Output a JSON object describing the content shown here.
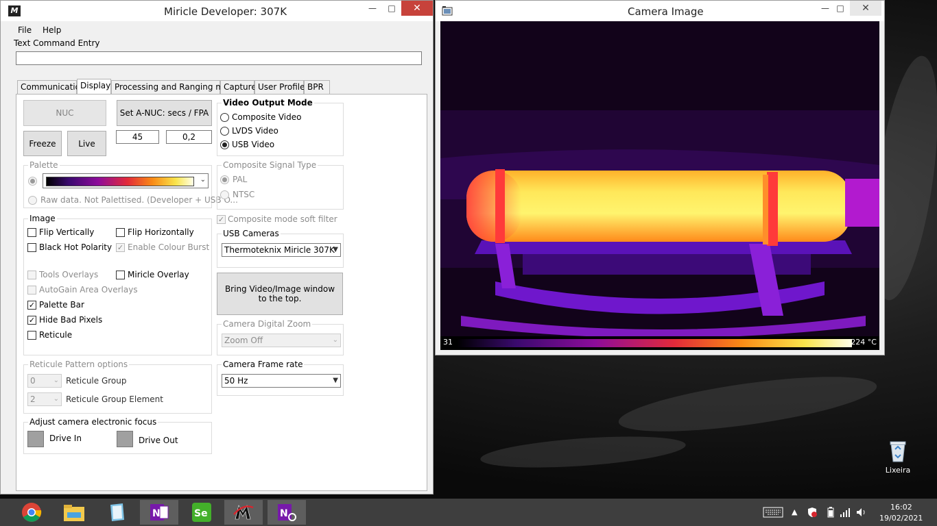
{
  "app_window": {
    "title": "Miricle Developer:  307K",
    "menu": {
      "file": "File",
      "help": "Help"
    },
    "text_command": {
      "label": "Text Command Entry",
      "value": ""
    },
    "tabs": [
      "Communications",
      "Display",
      "Processing and Ranging modes",
      "Capture",
      "User Profiles",
      "BPR"
    ],
    "active_tab": "Display",
    "buttons": {
      "nuc": "NUC",
      "set_anuc": "Set A-NUC:  secs / FPA",
      "freeze": "Freeze",
      "live": "Live",
      "bring_video": "Bring Video/Image window to the top."
    },
    "anuc_secs": "45",
    "anuc_fpa": "0,2",
    "video_output": {
      "title": "Video Output Mode",
      "options": [
        "Composite Video",
        "LVDS Video",
        "USB Video"
      ],
      "selected": "USB Video"
    },
    "palette": {
      "title": "Palette",
      "raw_label": "Raw data. Not Palettised. (Developer + USB O..."
    },
    "composite_signal": {
      "title": "Composite Signal Type",
      "options": [
        "PAL",
        "NTSC"
      ],
      "selected": "PAL"
    },
    "soft_filter": {
      "label": "Composite mode soft filter",
      "checked": true
    },
    "usb_cameras": {
      "title": "USB Cameras",
      "selected": "Thermoteknix Miricle 307K"
    },
    "image": {
      "title": "Image",
      "flip_vertically": {
        "label": "Flip Vertically",
        "checked": false
      },
      "flip_horizontally": {
        "label": "Flip Horizontally",
        "checked": false
      },
      "black_hot": {
        "label": "Black Hot Polarity",
        "checked": false
      },
      "colour_burst": {
        "label": "Enable Colour Burst",
        "checked": true
      },
      "tools_overlays": {
        "label": "Tools Overlays",
        "checked": false
      },
      "miricle_overlay": {
        "label": "Miricle Overlay",
        "checked": false
      },
      "autogain_overlays": {
        "label": "AutoGain Area Overlays",
        "checked": false
      },
      "palette_bar": {
        "label": "Palette Bar",
        "checked": true
      },
      "hide_bad_pixels": {
        "label": "Hide Bad Pixels",
        "checked": true
      },
      "reticule": {
        "label": "Reticule",
        "checked": false
      }
    },
    "digital_zoom": {
      "title": "Camera Digital Zoom",
      "selected": "Zoom Off"
    },
    "reticule_pattern": {
      "title": "Reticule Pattern options",
      "group_value": "0",
      "group_label": "Reticule Group",
      "element_value": "2",
      "element_label": "Reticule Group Element"
    },
    "frame_rate": {
      "title": "Camera Frame rate",
      "selected": "50 Hz"
    },
    "focus": {
      "title": "Adjust camera electronic focus",
      "drive_in": "Drive In",
      "drive_out": "Drive Out"
    }
  },
  "camera_window": {
    "title": "Camera Image",
    "scale_min": "31",
    "scale_max": "224 °C"
  },
  "desktop": {
    "recycle_bin": "Lixeira"
  },
  "taskbar": {
    "apps": [
      "chrome-icon",
      "file-explorer-icon",
      "notepad-icon",
      "onenote-icon",
      "selenium-icon",
      "miricle-icon",
      "onenote-tool-icon"
    ],
    "time": "16:02",
    "date": "19/02/2021"
  },
  "colors": {
    "close_red": "#c7423b",
    "accent_blue": "#0078d7",
    "taskbar": "#3e3e3e"
  }
}
